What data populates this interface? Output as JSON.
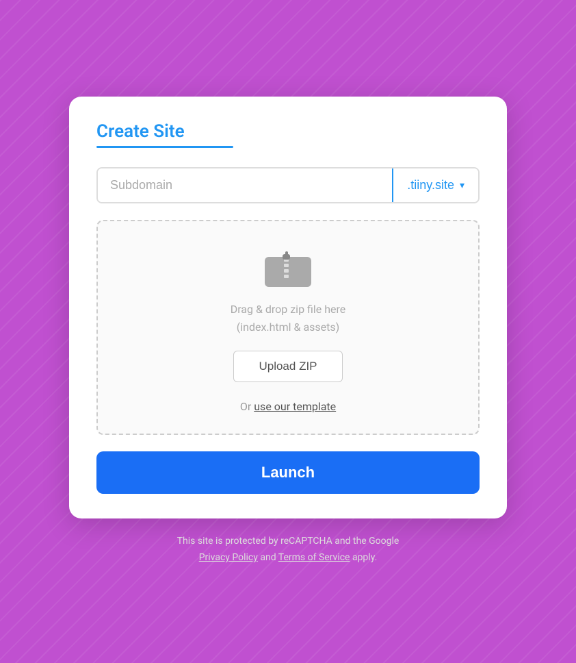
{
  "card": {
    "title": "Create Site",
    "subdomain": {
      "placeholder": "Subdomain",
      "domain_label": ".tiiny.site",
      "chevron": "▾"
    },
    "dropzone": {
      "drag_text_line1": "Drag & drop zip file here",
      "drag_text_line2": "(index.html & assets)",
      "upload_btn_label": "Upload ZIP",
      "or_text": "Or ",
      "template_link_text": "use our template"
    },
    "launch_btn_label": "Launch"
  },
  "footer": {
    "line1": "This site is protected by reCAPTCHA and the Google",
    "privacy_policy_text": "Privacy Policy",
    "and_text": " and ",
    "terms_text": "Terms of Service",
    "apply_text": " apply."
  }
}
